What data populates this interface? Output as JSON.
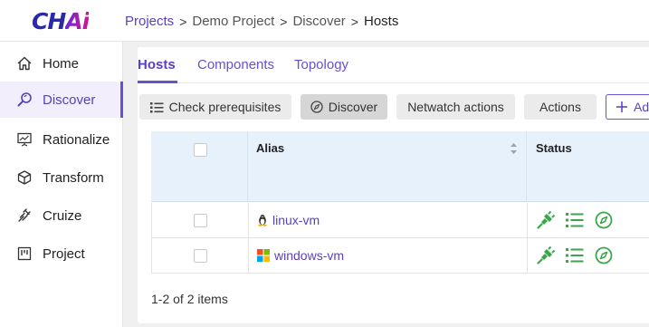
{
  "app": {
    "logo_main": "CH",
    "logo_accent": "Ai"
  },
  "breadcrumb": {
    "items": [
      "Projects",
      "Demo Project",
      "Discover"
    ],
    "current": "Hosts",
    "separator": ">"
  },
  "sidebar": {
    "items": [
      {
        "label": "Home",
        "icon": "home-icon"
      },
      {
        "label": "Discover",
        "icon": "discover-icon",
        "active": true
      },
      {
        "label": "Rationalize",
        "icon": "chart-board-icon"
      },
      {
        "label": "Transform",
        "icon": "cube-icon"
      },
      {
        "label": "Cruize",
        "icon": "cruize-icon"
      },
      {
        "label": "Project",
        "icon": "project-board-icon"
      }
    ]
  },
  "tabs": [
    {
      "label": "Hosts",
      "active": true
    },
    {
      "label": "Components"
    },
    {
      "label": "Topology"
    }
  ],
  "toolbar": {
    "check_prerequisites": "Check prerequisites",
    "discover": "Discover",
    "netwatch_actions": "Netwatch actions",
    "actions": "Actions",
    "add": "Add"
  },
  "table": {
    "columns": {
      "alias": "Alias",
      "status": "Status"
    },
    "rows": [
      {
        "alias": "linux-vm",
        "os": "linux-icon",
        "status_icons": [
          "plug-icon",
          "list-icon",
          "compass-icon"
        ]
      },
      {
        "alias": "windows-vm",
        "os": "windows-icon",
        "status_icons": [
          "plug-icon",
          "list-icon",
          "compass-icon"
        ]
      }
    ]
  },
  "pagination": {
    "summary": "1-2 of 2 items"
  },
  "colors": {
    "accent": "#5a3fc0",
    "status_green": "#3aa64a",
    "header_bg": "#e6f1fb"
  }
}
